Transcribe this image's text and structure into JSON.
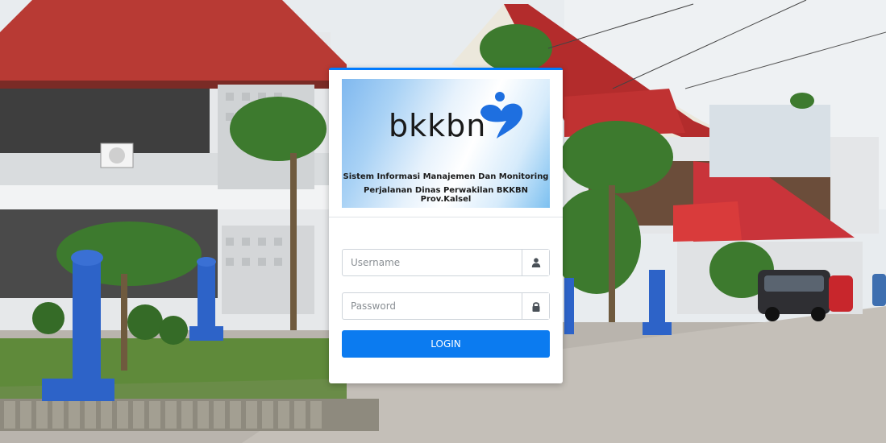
{
  "colors": {
    "accent": "#007bff",
    "button": "#0b7bf0",
    "logo_blue": "#1e6fe0"
  },
  "background": {
    "description_icon": "office-building-photo"
  },
  "login_card": {
    "logo": {
      "brand_text": "bkkbn",
      "title_line1": "Sistem Informasi Manajemen Dan Monitoring",
      "title_line2": "Perjalanan Dinas Perwakilan BKKBN Prov.Kalsel"
    },
    "username": {
      "placeholder": "Username",
      "value": "",
      "icon": "user-icon"
    },
    "password": {
      "placeholder": "Password",
      "value": "",
      "icon": "lock-icon"
    },
    "login_button": {
      "label": "LOGIN"
    }
  }
}
